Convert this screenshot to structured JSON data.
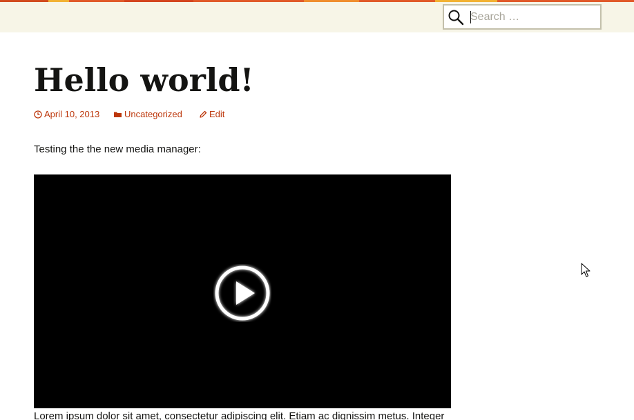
{
  "header": {
    "accent_colors": [
      "#e15a2a",
      "#f2b233",
      "#e15a2a",
      "#d4451f",
      "#f08e2e",
      "#e15a2a",
      "#f2b233",
      "#e15a2a"
    ],
    "background_color": "#f7f5e7",
    "search": {
      "icon": "search-icon",
      "placeholder": "Search …",
      "value": ""
    }
  },
  "post": {
    "title": "Hello world!",
    "meta": {
      "date": "April 10, 2013",
      "date_icon": "clock-icon",
      "category": "Uncategorized",
      "category_icon": "folder-icon",
      "edit_label": "Edit",
      "edit_icon": "pencil-icon",
      "link_color": "#bc360a"
    },
    "intro": "Testing the the new media manager:",
    "video": {
      "play_icon": "play-icon",
      "background_color": "#000000"
    },
    "body_text": "Lorem ipsum dolor sit amet, consectetur adipiscing elit. Etiam ac dignissim metus. Integer"
  },
  "cursor": {
    "icon": "mouse-pointer-icon"
  }
}
